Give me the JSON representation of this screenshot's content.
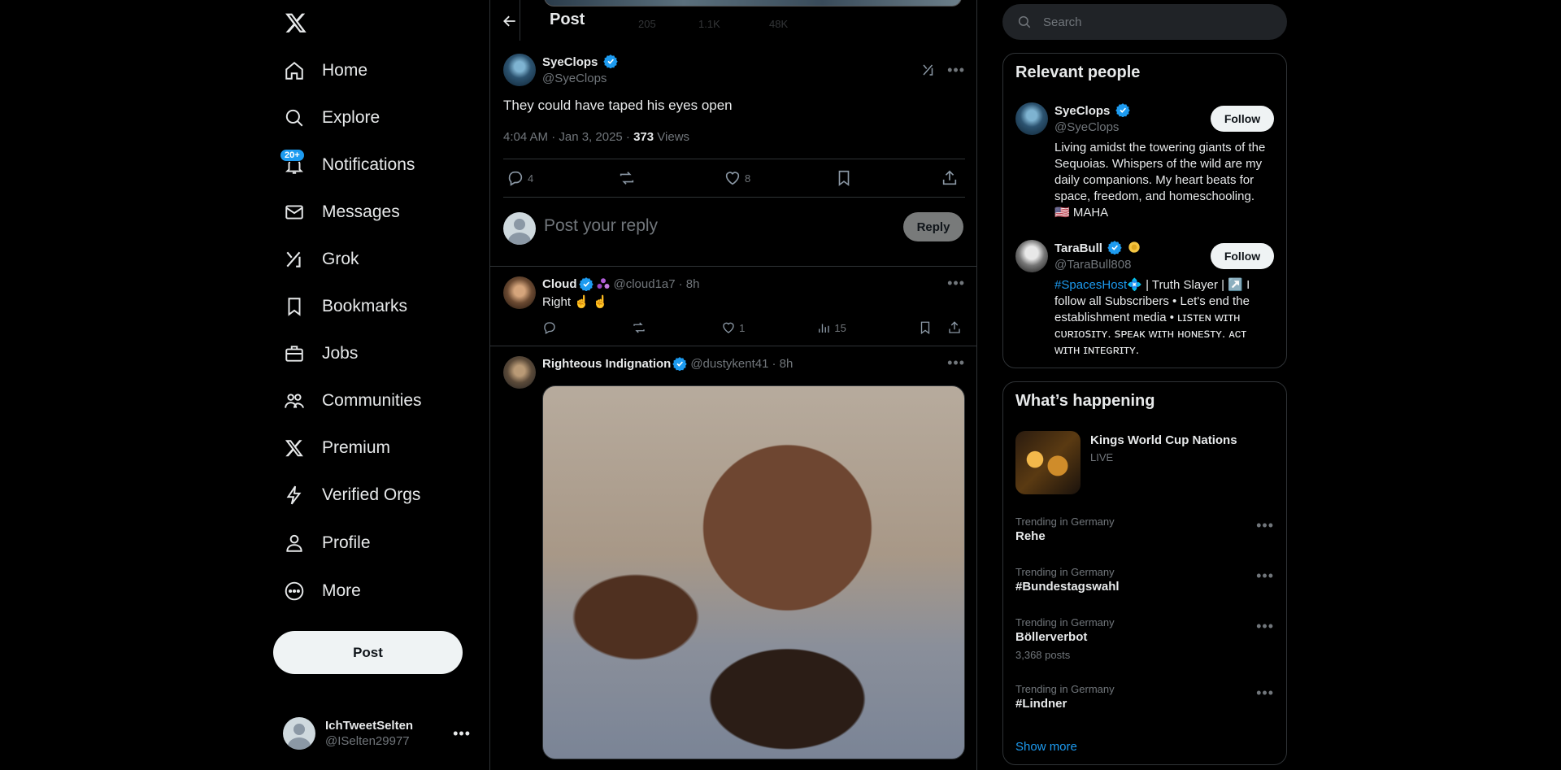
{
  "nav": {
    "items": [
      {
        "label": "Home",
        "icon": "home-icon"
      },
      {
        "label": "Explore",
        "icon": "search-icon"
      },
      {
        "label": "Notifications",
        "icon": "bell-icon",
        "badge": "20+"
      },
      {
        "label": "Messages",
        "icon": "mail-icon"
      },
      {
        "label": "Grok",
        "icon": "grok-icon"
      },
      {
        "label": "Bookmarks",
        "icon": "bookmark-icon"
      },
      {
        "label": "Jobs",
        "icon": "briefcase-icon"
      },
      {
        "label": "Communities",
        "icon": "communities-icon"
      },
      {
        "label": "Premium",
        "icon": "x-logo-icon"
      },
      {
        "label": "Verified Orgs",
        "icon": "lightning-icon"
      },
      {
        "label": "Profile",
        "icon": "person-icon"
      },
      {
        "label": "More",
        "icon": "more-circle-icon"
      }
    ],
    "post_button": "Post",
    "account": {
      "name": "IchTweetSelten",
      "handle": "@ISelten29977"
    }
  },
  "header": {
    "title": "Post",
    "ghost_stats": {
      "retweets": "205",
      "likes": "1.1K",
      "views": "48K"
    }
  },
  "main_post": {
    "author_name": "SyeClops",
    "author_handle": "@SyeClops",
    "text": "They could have taped his eyes open",
    "time": "4:04 AM · Jan 3, 2025 · ",
    "views_count": "373",
    "views_label": " Views",
    "replies": "4",
    "likes": "8"
  },
  "reply_composer": {
    "placeholder": "Post your reply",
    "button": "Reply"
  },
  "replies": [
    {
      "name": "Cloud",
      "handle": "@cloud1a7",
      "time": "· 8h",
      "text": "Right ☝️ ☝️",
      "likes": "1",
      "views": "15"
    },
    {
      "name": "Righteous Indignation",
      "handle": "@dustykent41",
      "time": "· 8h"
    }
  ],
  "search": {
    "placeholder": "Search"
  },
  "relevant_people": {
    "title": "Relevant people",
    "people": [
      {
        "name": "SyeClops",
        "handle": "@SyeClops",
        "bio": "Living amidst the towering giants of the Sequoias. Whispers of the wild are my daily companions. My heart beats for space, freedom, and homeschooling. 🇺🇸 MAHA",
        "button": "Follow"
      },
      {
        "name": "TaraBull",
        "handle": "@TaraBull808",
        "bio_link": "#SpacesHost",
        "bio_rest": "💠 | Truth Slayer | ↗️ I follow all Subscribers • Let's end the establishment media • ʟɪꜱᴛᴇɴ ᴡɪᴛʜ ᴄᴜʀɪᴏꜱɪᴛʏ. ꜱᴘᴇᴀᴋ ᴡɪᴛʜ ʜᴏɴᴇꜱᴛʏ. ᴀᴄᴛ ᴡɪᴛʜ ɪɴᴛᴇɢʀɪᴛʏ.",
        "button": "Follow"
      }
    ]
  },
  "whats_happening": {
    "title": "What’s happening",
    "event": {
      "title": "Kings World Cup Nations",
      "status": "LIVE"
    },
    "trends": [
      {
        "context": "Trending in Germany",
        "title": "Rehe",
        "count": ""
      },
      {
        "context": "Trending in Germany",
        "title": "#Bundestagswahl",
        "count": ""
      },
      {
        "context": "Trending in Germany",
        "title": "Böllerverbot",
        "count": "3,368 posts"
      },
      {
        "context": "Trending in Germany",
        "title": "#Lindner",
        "count": ""
      }
    ],
    "show_more": "Show more"
  },
  "colors": {
    "accent": "#1d9bf0",
    "background": "#000000",
    "border": "#2f3336",
    "muted": "#71767b"
  }
}
